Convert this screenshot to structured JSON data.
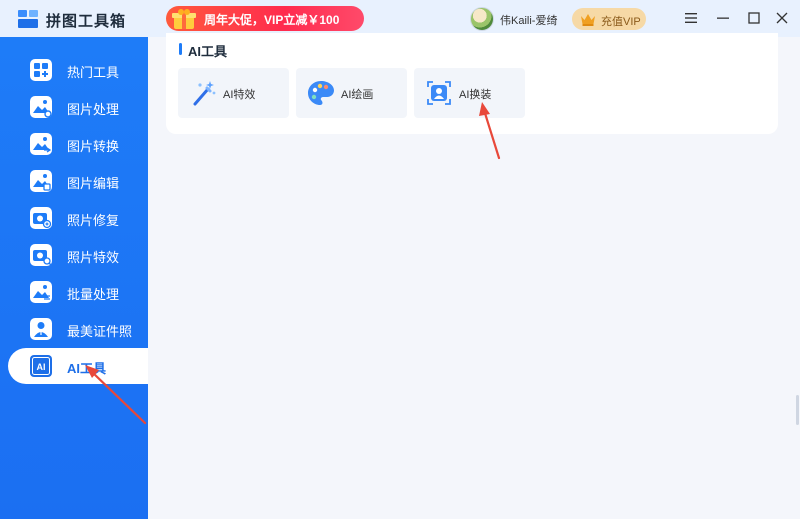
{
  "app": {
    "title": "拼图工具箱"
  },
  "promo": {
    "text": "周年大促，VIP立减￥100"
  },
  "user": {
    "name": "伟Kaili-爱绮"
  },
  "vip": {
    "label": "充值VIP"
  },
  "sidebar": {
    "items": [
      {
        "label": "热门工具",
        "icon": "hot-tools-icon"
      },
      {
        "label": "图片处理",
        "icon": "image-process-icon"
      },
      {
        "label": "图片转换",
        "icon": "image-convert-icon"
      },
      {
        "label": "图片编辑",
        "icon": "image-edit-icon"
      },
      {
        "label": "照片修复",
        "icon": "photo-repair-icon"
      },
      {
        "label": "照片特效",
        "icon": "photo-effect-icon"
      },
      {
        "label": "批量处理",
        "icon": "batch-process-icon"
      },
      {
        "label": "最美证件照",
        "icon": "id-photo-icon"
      },
      {
        "label": "AI工具",
        "icon": "ai-icon",
        "active": true
      }
    ]
  },
  "main": {
    "section_title": "AI工具",
    "tools": [
      {
        "label": "AI特效",
        "icon": "magic-wand-icon"
      },
      {
        "label": "AI绘画",
        "icon": "palette-icon"
      },
      {
        "label": "AI换装",
        "icon": "outfit-swap-icon"
      }
    ]
  },
  "colors": {
    "accent": "#1e7cf8",
    "promo": "#ff3b4a",
    "annotation": "#e8483a"
  }
}
